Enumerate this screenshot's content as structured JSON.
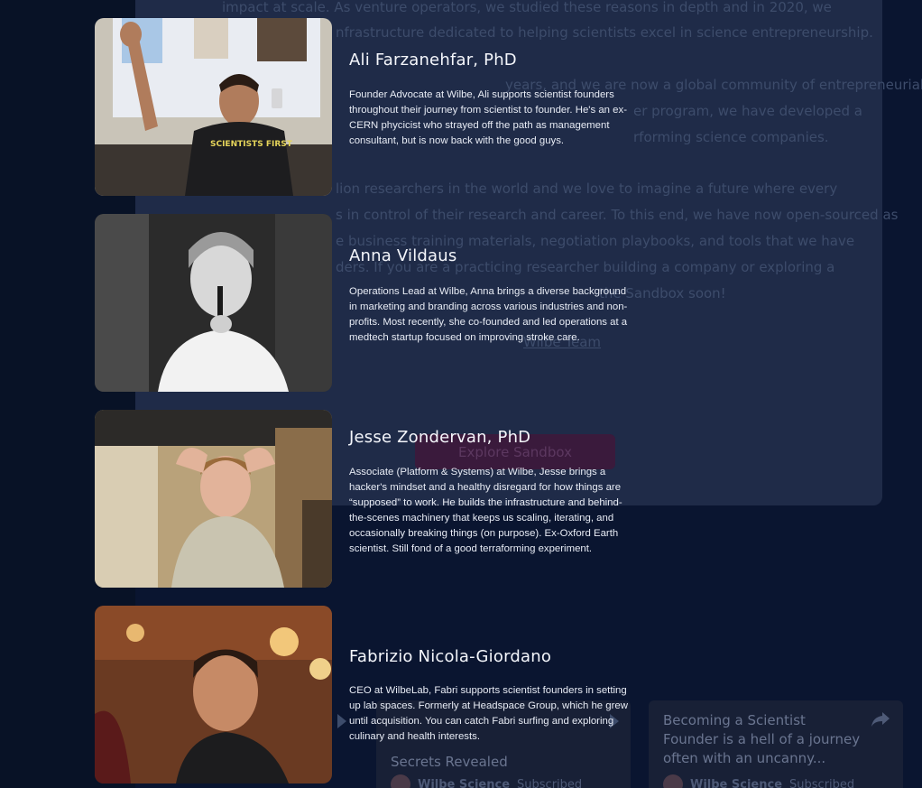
{
  "background": {
    "paragraph_lines": [
      "impact at scale. As venture operators, we studied these reasons in depth and in 2020, we",
      "nfrastructure dedicated to helping scientists excel in science entrepreneurship.",
      "years, and we are now a global community of entrepreneurial researchers",
      "er program, we have developed a",
      "rforming science companies.",
      "lion researchers in the world and we love to imagine a future where every",
      "s in control of their research and career. To this end, we have now open-sourced as",
      "e business training materials, negotiation playbooks, and tools that we have",
      "ders. If you are a practicing researcher building a company or exploring a",
      "the Sandbox soon!"
    ],
    "link_text": "Wilbe Team",
    "cta_label": "Explore Sandbox",
    "videos": [
      {
        "title": "Secrets Revealed",
        "channel": "Wilbe Science",
        "status": "Subscribed"
      },
      {
        "title": "Becoming a Scientist Founder is a hell of a journey often with an uncanny...",
        "channel": "Wilbe Science",
        "status": "Subscribed"
      }
    ]
  },
  "team": [
    {
      "name": "Ali Farzanehfar, PhD",
      "bio": "Founder Advocate at Wilbe, Ali supports scientist founders throughout their journey from scientist to founder. He's an ex-CERN phycicist who strayed off the path as management consultant, but is now back with the good guys.",
      "photo_shirt_text": "SCIENTISTS FIRST"
    },
    {
      "name": "Anna Vildaus",
      "bio": "Operations Lead at Wilbe, Anna brings a diverse background in marketing and branding across various industries and non-profits. Most recently, she co-founded and led operations at a medtech startup focused on improving stroke care."
    },
    {
      "name": "Jesse Zondervan, PhD",
      "bio": "Associate (Platform & Systems) at Wilbe, Jesse brings a hacker's mindset and a healthy disregard for how things are “supposed” to work. He builds the infrastructure and behind-the-scenes machinery that keeps us scaling, iterating, and occasionally breaking things (on purpose). Ex-Oxford Earth scientist. Still fond of a good terraforming experiment."
    },
    {
      "name": "Fabrizio Nicola-Giordano",
      "bio": "CEO at WilbeLab, Fabri supports scientist founders in setting up lab spaces. Formerly at Headspace Group, which he grew until acquisition. You can catch Fabri surfing and exploring culinary and health interests."
    }
  ],
  "colors": {
    "page_background": "#0a1530",
    "name_text": "#f4f6fb",
    "bio_text": "#e8ecf5"
  }
}
